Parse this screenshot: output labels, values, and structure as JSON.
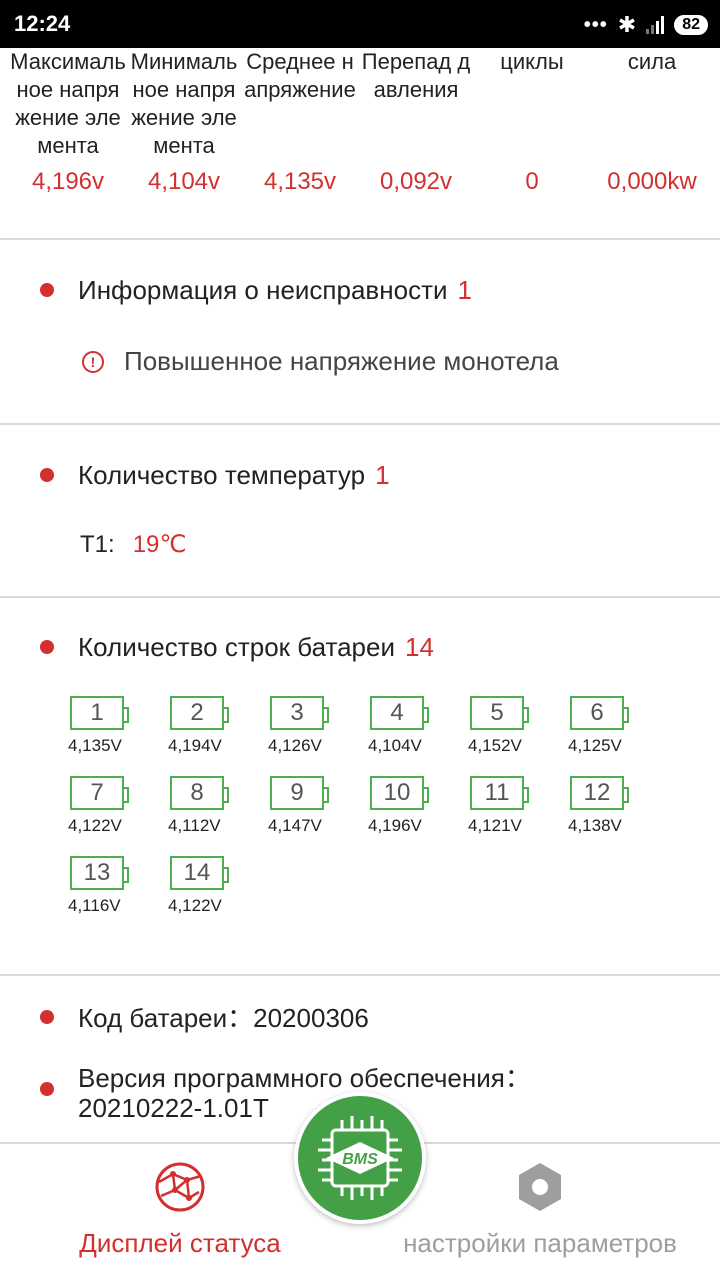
{
  "statusbar": {
    "time": "12:24",
    "battery": "82"
  },
  "stats": [
    {
      "label": "Максимальное напряжение элемента",
      "value": "4,196v"
    },
    {
      "label": "Минимальное напряжение элемента",
      "value": "4,104v"
    },
    {
      "label": "Среднее напряжение",
      "value": "4,135v"
    },
    {
      "label": "Перепад давления",
      "value": "0,092v"
    },
    {
      "label": "циклы",
      "value": "0"
    },
    {
      "label": "сила",
      "value": "0,000kw"
    }
  ],
  "fault": {
    "title": "Информация о неисправности",
    "count": "1",
    "items": [
      {
        "icon": "warning-icon",
        "text": "Повышенное напряжение монотела"
      }
    ]
  },
  "temperature": {
    "title": "Количество температур",
    "count": "1",
    "items": [
      {
        "label": "T1:",
        "value": "19℃"
      }
    ]
  },
  "cells": {
    "title": "Количество строк батареи",
    "count": "14",
    "items": [
      {
        "num": "1",
        "voltage": "4,135V"
      },
      {
        "num": "2",
        "voltage": "4,194V"
      },
      {
        "num": "3",
        "voltage": "4,126V"
      },
      {
        "num": "4",
        "voltage": "4,104V"
      },
      {
        "num": "5",
        "voltage": "4,152V"
      },
      {
        "num": "6",
        "voltage": "4,125V"
      },
      {
        "num": "7",
        "voltage": "4,122V"
      },
      {
        "num": "8",
        "voltage": "4,112V"
      },
      {
        "num": "9",
        "voltage": "4,147V"
      },
      {
        "num": "10",
        "voltage": "4,196V"
      },
      {
        "num": "11",
        "voltage": "4,121V"
      },
      {
        "num": "12",
        "voltage": "4,138V"
      },
      {
        "num": "13",
        "voltage": "4,116V"
      },
      {
        "num": "14",
        "voltage": "4,122V"
      }
    ]
  },
  "battery_code": {
    "label": "Код батареи：",
    "value": "20200306"
  },
  "firmware": {
    "label": "Версия программного обеспечения：",
    "value": "20210222-1.01T"
  },
  "nav": {
    "left_label": "Дисплей статуса",
    "center_label": "BMS",
    "right_label": "настройки параметров"
  },
  "colors": {
    "accent": "#d32f2f",
    "cell_border": "#4caf50",
    "bms_green": "#43a047"
  }
}
